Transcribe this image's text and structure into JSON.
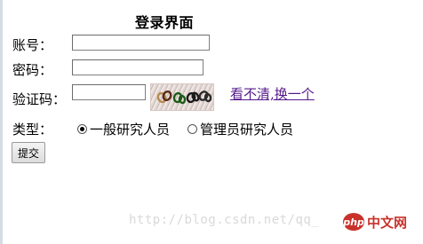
{
  "form": {
    "title": "登录界面",
    "account_label": "账号：",
    "password_label": "密码：",
    "captcha_label": "验证码：",
    "captcha_refresh_link": "看不清,换一个",
    "type_label": "类型：",
    "type_options": [
      {
        "label": "一般研究人员",
        "checked": true
      },
      {
        "label": "管理员研究人员",
        "checked": false
      }
    ],
    "submit_label": "提交"
  },
  "watermark": {
    "text": "http://blog.csdn.net/qq_"
  },
  "logo": {
    "badge": "php",
    "text": "中文网"
  },
  "colors": {
    "link": "#551a8b",
    "logo": "#c8322b"
  }
}
